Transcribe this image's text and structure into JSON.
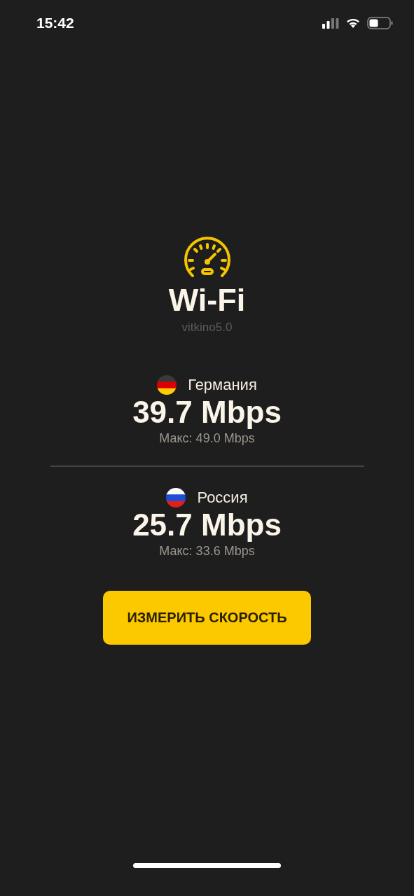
{
  "status_bar": {
    "time": "15:42"
  },
  "connection": {
    "title": "Wi-Fi",
    "network": "vitkino5.0"
  },
  "servers": [
    {
      "country": "Германия",
      "kind": "germany",
      "speed": "39.7 Mbps",
      "max": "Макс: 49.0 Mbps"
    },
    {
      "country": "Россия",
      "kind": "russia",
      "speed": "25.7 Mbps",
      "max": "Макс: 33.6 Mbps"
    }
  ],
  "button": {
    "label": "ИЗМЕРИТЬ СКОРОСТЬ"
  }
}
